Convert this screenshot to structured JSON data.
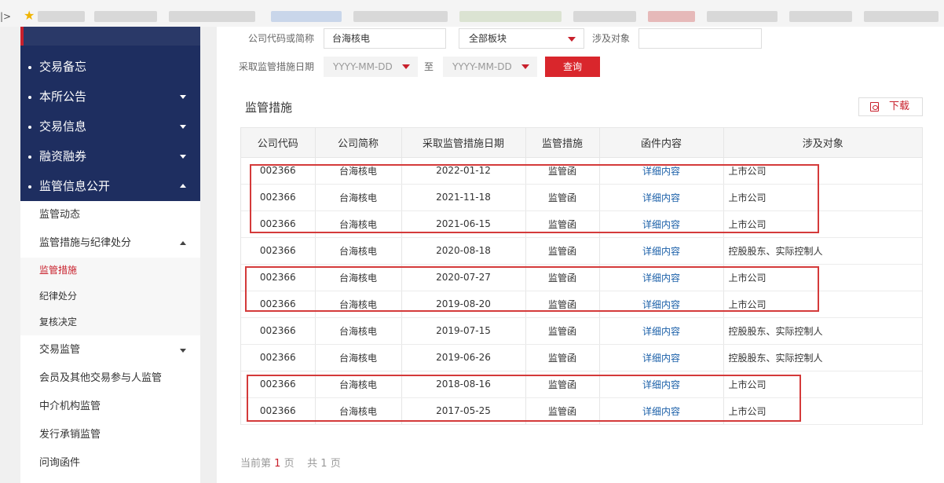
{
  "browser": {
    "edge_glyph": "|>",
    "bookmark_icon": "star-icon"
  },
  "sidebar": {
    "top_items": [
      {
        "label": "交易备忘",
        "caret": "none"
      },
      {
        "label": "本所公告",
        "caret": "down"
      },
      {
        "label": "交易信息",
        "caret": "down"
      },
      {
        "label": "融资融券",
        "caret": "down"
      },
      {
        "label": "监管信息公开",
        "caret": "up"
      }
    ],
    "sub_items": [
      {
        "label": "监管动态"
      },
      {
        "label": "监管措施与纪律处分"
      }
    ],
    "subsub_items": [
      {
        "label": "监管措施",
        "active": true
      },
      {
        "label": "纪律处分",
        "active": false
      },
      {
        "label": "复核决定",
        "active": false
      }
    ],
    "more_items": [
      {
        "label": "交易监管"
      },
      {
        "label": "会员及其他交易参与人监管"
      },
      {
        "label": "中介机构监管"
      },
      {
        "label": "发行承销监管"
      },
      {
        "label": "问询函件"
      }
    ]
  },
  "filters": {
    "company_label": "公司代码或简称",
    "company_value": "台海核电",
    "board_value": "全部板块",
    "involved_label": "涉及对象",
    "involved_value": "",
    "date_label": "采取监管措施日期",
    "date_from_placeholder": "YYYY-MM-DD",
    "date_to_text": "至",
    "date_to_placeholder": "YYYY-MM-DD",
    "query_label": "查询"
  },
  "section": {
    "title": "监管措施",
    "download_label": "下载"
  },
  "table": {
    "headers": [
      "公司代码",
      "公司简称",
      "采取监管措施日期",
      "监管措施",
      "函件内容",
      "涉及对象"
    ],
    "rows": [
      [
        "002366",
        "台海核电",
        "2022-01-12",
        "监管函",
        "详细内容",
        "上市公司"
      ],
      [
        "002366",
        "台海核电",
        "2021-11-18",
        "监管函",
        "详细内容",
        "上市公司"
      ],
      [
        "002366",
        "台海核电",
        "2021-06-15",
        "监管函",
        "详细内容",
        "上市公司"
      ],
      [
        "002366",
        "台海核电",
        "2020-08-18",
        "监管函",
        "详细内容",
        "控股股东、实际控制人"
      ],
      [
        "002366",
        "台海核电",
        "2020-07-27",
        "监管函",
        "详细内容",
        "上市公司"
      ],
      [
        "002366",
        "台海核电",
        "2019-08-20",
        "监管函",
        "详细内容",
        "上市公司"
      ],
      [
        "002366",
        "台海核电",
        "2019-07-15",
        "监管函",
        "详细内容",
        "控股股东、实际控制人"
      ],
      [
        "002366",
        "台海核电",
        "2019-06-26",
        "监管函",
        "详细内容",
        "控股股东、实际控制人"
      ],
      [
        "002366",
        "台海核电",
        "2018-08-16",
        "监管函",
        "详细内容",
        "上市公司"
      ],
      [
        "002366",
        "台海核电",
        "2017-05-25",
        "监管函",
        "详细内容",
        "上市公司"
      ]
    ]
  },
  "pager": {
    "prefix": "当前第",
    "current": "1",
    "page_unit": "页",
    "total_prefix": "共",
    "total": "1",
    "total_unit": "页"
  },
  "colors": {
    "nav_dark": "#1e2e60",
    "accent_red": "#d9262c",
    "link_blue": "#1a5fa8",
    "highlight_box": "#d43a3a"
  }
}
